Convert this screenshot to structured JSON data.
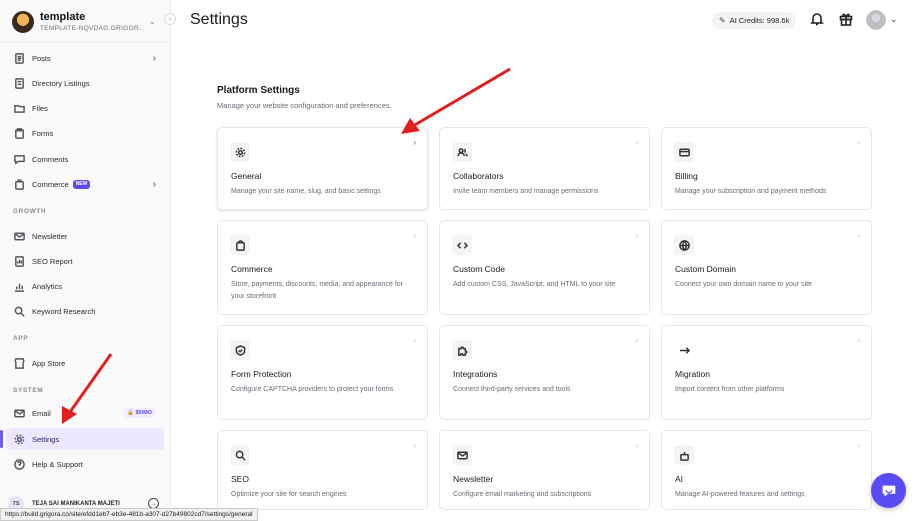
{
  "workspace": {
    "name": "template",
    "slug": "TEMPLATE-NQVDAG.GRIGOR..."
  },
  "sidebar": {
    "items": [
      {
        "label": "Posts",
        "icon": "document-icon"
      },
      {
        "label": "Directory Listings",
        "icon": "list-icon"
      },
      {
        "label": "Files",
        "icon": "folder-icon"
      },
      {
        "label": "Forms",
        "icon": "clipboard-icon"
      },
      {
        "label": "Comments",
        "icon": "comment-icon"
      },
      {
        "label": "Commerce",
        "icon": "bag-icon",
        "badge": "NEW"
      }
    ],
    "growth_label": "GROWTH",
    "growth": [
      {
        "label": "Newsletter",
        "icon": "mail-icon"
      },
      {
        "label": "SEO Report",
        "icon": "report-icon"
      },
      {
        "label": "Analytics",
        "icon": "chart-icon"
      },
      {
        "label": "Keyword Research",
        "icon": "search-icon"
      }
    ],
    "app_label": "APP",
    "app": [
      {
        "label": "App Store",
        "icon": "store-icon"
      }
    ],
    "system_label": "SYSTEM",
    "system": [
      {
        "label": "Email",
        "icon": "mail-icon",
        "badge": "$5/MO"
      },
      {
        "label": "Settings",
        "icon": "gear-icon"
      },
      {
        "label": "Help & Support",
        "icon": "help-icon"
      }
    ],
    "user": {
      "initials": "TS",
      "name": "TEJA SAI MANIKANTA MAJETI"
    }
  },
  "header": {
    "title": "Settings",
    "credits": "AI Credits: 998.6k"
  },
  "main": {
    "section_title": "Platform Settings",
    "section_desc": "Manage your website configuration and preferences.",
    "cards": [
      {
        "title": "General",
        "desc": "Manage your site name, slug, and basic settings",
        "icon": "gear-icon"
      },
      {
        "title": "Collaborators",
        "desc": "Invite team members and manage permissions",
        "icon": "users-icon"
      },
      {
        "title": "Billing",
        "desc": "Manage your subscription and payment methods",
        "icon": "card-icon"
      },
      {
        "title": "Commerce",
        "desc": "Store, payments, discounts, media, and appearance for your storefront",
        "icon": "bag-icon"
      },
      {
        "title": "Custom Code",
        "desc": "Add custom CSS, JavaScript, and HTML to your site",
        "icon": "code-icon"
      },
      {
        "title": "Custom Domain",
        "desc": "Connect your own domain name to your site",
        "icon": "globe-icon"
      },
      {
        "title": "Form Protection",
        "desc": "Configure CAPTCHA providers to protect your forms",
        "icon": "shield-icon"
      },
      {
        "title": "Integrations",
        "desc": "Connect third-party services and tools",
        "icon": "puzzle-icon"
      },
      {
        "title": "Migration",
        "desc": "Import content from other platforms",
        "icon": "arrow-right-icon"
      },
      {
        "title": "SEO",
        "desc": "Optimize your site for search engines",
        "icon": "search-icon"
      },
      {
        "title": "Newsletter",
        "desc": "Configure email marketing and subscriptions",
        "icon": "mail-icon"
      },
      {
        "title": "AI",
        "desc": "Manage AI-powered features and settings",
        "icon": "robot-icon"
      }
    ]
  },
  "status_url": "https://build.grigora.co/site/efdd1eb7-eb3e-481b-a307-d27b49802cd7/settings/general",
  "colors": {
    "accent": "#5b4cf0",
    "annotation_arrow": "#e02020"
  }
}
